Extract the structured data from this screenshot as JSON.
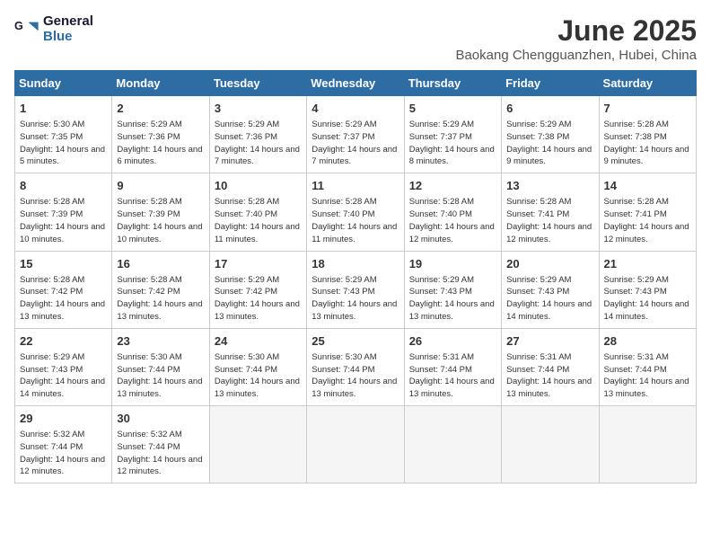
{
  "logo": {
    "line1": "General",
    "line2": "Blue"
  },
  "title": "June 2025",
  "subtitle": "Baokang Chengguanzhen, Hubei, China",
  "weekdays": [
    "Sunday",
    "Monday",
    "Tuesday",
    "Wednesday",
    "Thursday",
    "Friday",
    "Saturday"
  ],
  "weeks": [
    [
      {
        "day": 1,
        "sunrise": "5:30 AM",
        "sunset": "7:35 PM",
        "daylight": "14 hours and 5 minutes."
      },
      {
        "day": 2,
        "sunrise": "5:29 AM",
        "sunset": "7:36 PM",
        "daylight": "14 hours and 6 minutes."
      },
      {
        "day": 3,
        "sunrise": "5:29 AM",
        "sunset": "7:36 PM",
        "daylight": "14 hours and 7 minutes."
      },
      {
        "day": 4,
        "sunrise": "5:29 AM",
        "sunset": "7:37 PM",
        "daylight": "14 hours and 7 minutes."
      },
      {
        "day": 5,
        "sunrise": "5:29 AM",
        "sunset": "7:37 PM",
        "daylight": "14 hours and 8 minutes."
      },
      {
        "day": 6,
        "sunrise": "5:29 AM",
        "sunset": "7:38 PM",
        "daylight": "14 hours and 9 minutes."
      },
      {
        "day": 7,
        "sunrise": "5:28 AM",
        "sunset": "7:38 PM",
        "daylight": "14 hours and 9 minutes."
      }
    ],
    [
      {
        "day": 8,
        "sunrise": "5:28 AM",
        "sunset": "7:39 PM",
        "daylight": "14 hours and 10 minutes."
      },
      {
        "day": 9,
        "sunrise": "5:28 AM",
        "sunset": "7:39 PM",
        "daylight": "14 hours and 10 minutes."
      },
      {
        "day": 10,
        "sunrise": "5:28 AM",
        "sunset": "7:40 PM",
        "daylight": "14 hours and 11 minutes."
      },
      {
        "day": 11,
        "sunrise": "5:28 AM",
        "sunset": "7:40 PM",
        "daylight": "14 hours and 11 minutes."
      },
      {
        "day": 12,
        "sunrise": "5:28 AM",
        "sunset": "7:40 PM",
        "daylight": "14 hours and 12 minutes."
      },
      {
        "day": 13,
        "sunrise": "5:28 AM",
        "sunset": "7:41 PM",
        "daylight": "14 hours and 12 minutes."
      },
      {
        "day": 14,
        "sunrise": "5:28 AM",
        "sunset": "7:41 PM",
        "daylight": "14 hours and 12 minutes."
      }
    ],
    [
      {
        "day": 15,
        "sunrise": "5:28 AM",
        "sunset": "7:42 PM",
        "daylight": "14 hours and 13 minutes."
      },
      {
        "day": 16,
        "sunrise": "5:28 AM",
        "sunset": "7:42 PM",
        "daylight": "14 hours and 13 minutes."
      },
      {
        "day": 17,
        "sunrise": "5:29 AM",
        "sunset": "7:42 PM",
        "daylight": "14 hours and 13 minutes."
      },
      {
        "day": 18,
        "sunrise": "5:29 AM",
        "sunset": "7:43 PM",
        "daylight": "14 hours and 13 minutes."
      },
      {
        "day": 19,
        "sunrise": "5:29 AM",
        "sunset": "7:43 PM",
        "daylight": "14 hours and 13 minutes."
      },
      {
        "day": 20,
        "sunrise": "5:29 AM",
        "sunset": "7:43 PM",
        "daylight": "14 hours and 14 minutes."
      },
      {
        "day": 21,
        "sunrise": "5:29 AM",
        "sunset": "7:43 PM",
        "daylight": "14 hours and 14 minutes."
      }
    ],
    [
      {
        "day": 22,
        "sunrise": "5:29 AM",
        "sunset": "7:43 PM",
        "daylight": "14 hours and 14 minutes."
      },
      {
        "day": 23,
        "sunrise": "5:30 AM",
        "sunset": "7:44 PM",
        "daylight": "14 hours and 13 minutes."
      },
      {
        "day": 24,
        "sunrise": "5:30 AM",
        "sunset": "7:44 PM",
        "daylight": "14 hours and 13 minutes."
      },
      {
        "day": 25,
        "sunrise": "5:30 AM",
        "sunset": "7:44 PM",
        "daylight": "14 hours and 13 minutes."
      },
      {
        "day": 26,
        "sunrise": "5:31 AM",
        "sunset": "7:44 PM",
        "daylight": "14 hours and 13 minutes."
      },
      {
        "day": 27,
        "sunrise": "5:31 AM",
        "sunset": "7:44 PM",
        "daylight": "14 hours and 13 minutes."
      },
      {
        "day": 28,
        "sunrise": "5:31 AM",
        "sunset": "7:44 PM",
        "daylight": "14 hours and 13 minutes."
      }
    ],
    [
      {
        "day": 29,
        "sunrise": "5:32 AM",
        "sunset": "7:44 PM",
        "daylight": "14 hours and 12 minutes."
      },
      {
        "day": 30,
        "sunrise": "5:32 AM",
        "sunset": "7:44 PM",
        "daylight": "14 hours and 12 minutes."
      },
      null,
      null,
      null,
      null,
      null
    ]
  ]
}
